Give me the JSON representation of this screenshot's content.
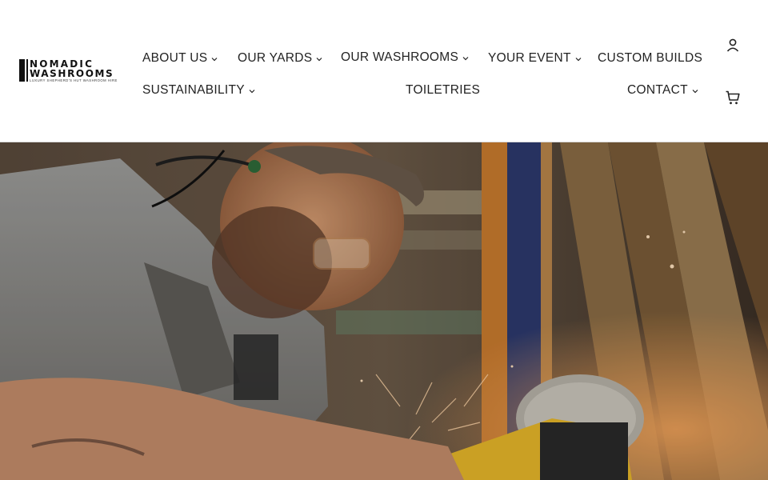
{
  "brand": {
    "logo_line1": "NOMADIC",
    "logo_line2": "WASHROOMS",
    "logo_tagline": "Luxury Shepherd's Hut Washroom Hire"
  },
  "nav": {
    "about": "ABOUT US",
    "yards": "OUR YARDS",
    "washrooms": "OUR WASHROOMS",
    "event": "YOUR EVENT",
    "custom": "CUSTOM BUILDS",
    "sustainability": "SUSTAINABILITY",
    "toiletries": "TOILETRIES",
    "contact": "CONTACT"
  },
  "icons": {
    "account": "account-icon",
    "cart": "cart-icon",
    "dropdown": "chevron-down-icon"
  },
  "colors": {
    "header_bg": "#ffffff",
    "text": "#222222",
    "divider": "#d9d9d9"
  }
}
